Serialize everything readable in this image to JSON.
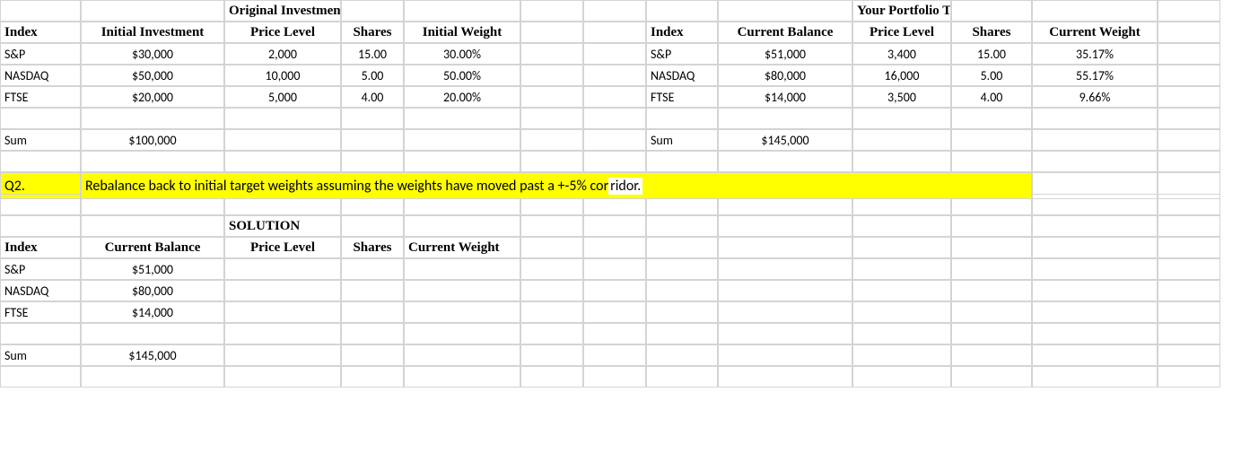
{
  "titles": {
    "original": "Original Investment",
    "portfolio": "Your Portfolio Today",
    "solution": "SOLUTION"
  },
  "headers": {
    "index": "Index",
    "initial_investment": "Initial Investment",
    "price_level": "Price Level",
    "shares": "Shares",
    "initial_weight": "Initial Weight",
    "current_balance": "Current Balance",
    "current_weight": "Current Weight"
  },
  "original": {
    "rows": [
      {
        "index": "S&P",
        "initial_investment": "$30,000",
        "price_level": "2,000",
        "shares": "15.00",
        "initial_weight": "30.00%"
      },
      {
        "index": "NASDAQ",
        "initial_investment": "$50,000",
        "price_level": "10,000",
        "shares": "5.00",
        "initial_weight": "50.00%"
      },
      {
        "index": "FTSE",
        "initial_investment": "$20,000",
        "price_level": "5,000",
        "shares": "4.00",
        "initial_weight": "20.00%"
      }
    ],
    "sum_label": "Sum",
    "sum_value": "$100,000"
  },
  "portfolio": {
    "rows": [
      {
        "index": "S&P",
        "current_balance": "$51,000",
        "price_level": "3,400",
        "shares": "15.00",
        "current_weight": "35.17%"
      },
      {
        "index": "NASDAQ",
        "current_balance": "$80,000",
        "price_level": "16,000",
        "shares": "5.00",
        "current_weight": "55.17%"
      },
      {
        "index": "FTSE",
        "current_balance": "$14,000",
        "price_level": "3,500",
        "shares": "4.00",
        "current_weight": "9.66%"
      }
    ],
    "sum_label": "Sum",
    "sum_value": "$145,000"
  },
  "question": {
    "label": "Q2.",
    "text_hl": "Rebalance back to initial target weights assuming the weights have moved past a +-5% cor",
    "text_rest": "ridor."
  },
  "solution": {
    "rows": [
      {
        "index": "S&P",
        "current_balance": "$51,000"
      },
      {
        "index": "NASDAQ",
        "current_balance": "$80,000"
      },
      {
        "index": "FTSE",
        "current_balance": "$14,000"
      }
    ],
    "sum_label": "Sum",
    "sum_value": "$145,000"
  }
}
